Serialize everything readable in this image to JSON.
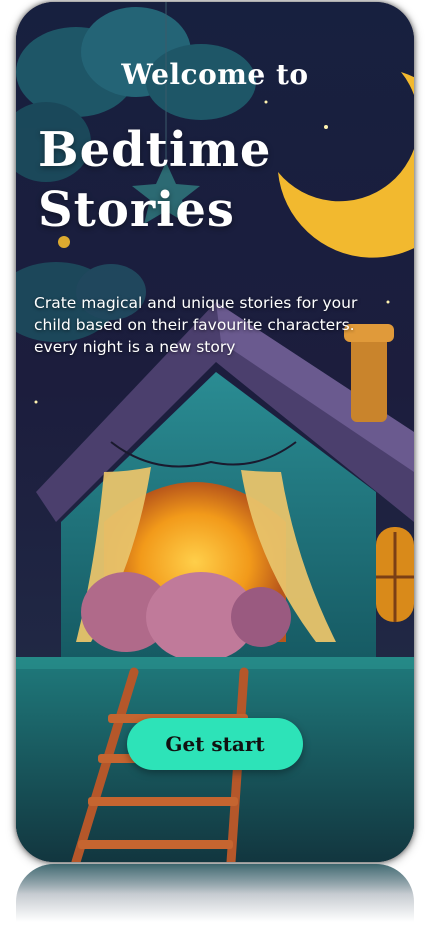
{
  "onboarding": {
    "welcome_text": "Welcome to",
    "title_line1": "Bedtime",
    "title_line2": "Stories",
    "description": "Crate magical and unique stories for your child based on their favourite characters. every night is a new story",
    "cta_label": "Get start"
  },
  "colors": {
    "cta_background": "#2de3b8",
    "background_night": "#1a1b3a",
    "moon": "#f2b92f",
    "house_wall": "#1f6f78",
    "roof": "#5a4a7a",
    "window_glow": "#f4a21d"
  },
  "icons": [
    "moon-icon",
    "star-icon",
    "cloud-icon",
    "house-illustration",
    "ladder-illustration"
  ]
}
